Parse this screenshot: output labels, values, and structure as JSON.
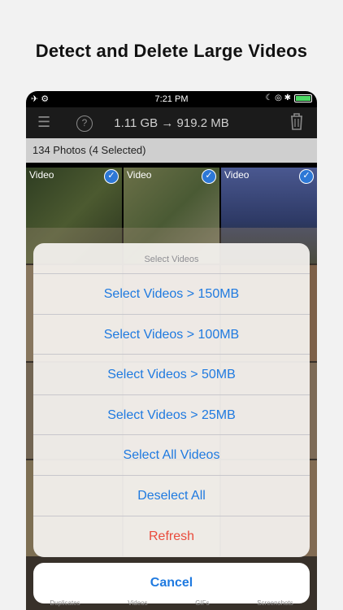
{
  "headline": "Detect and Delete Large Videos",
  "status": {
    "time": "7:21 PM",
    "left_icons": "✈ ⚙",
    "right_icons": "☾ ◎ ✱"
  },
  "toolbar": {
    "size_text": "1.11 GB → 919.2 MB",
    "help_label": "?"
  },
  "count_text": "134 Photos (4 Selected)",
  "tiles": [
    {
      "label": "Video",
      "selected": true,
      "color": "#3b4a2a"
    },
    {
      "label": "Video",
      "selected": true,
      "color": "#566040"
    },
    {
      "label": "Video",
      "selected": true,
      "color": "#3e4a78"
    }
  ],
  "sheet": {
    "title": "Select Videos",
    "options": [
      "Select Videos > 150MB",
      "Select Videos > 100MB",
      "Select Videos > 50MB",
      "Select Videos > 25MB",
      "Select All Videos",
      "Deselect All",
      "Refresh"
    ],
    "cancel": "Cancel"
  },
  "tabbar": [
    "Duplicates",
    "Videos",
    "GIFs",
    "Screenshots"
  ],
  "colors": {
    "accent": "#1f7ae0",
    "destructive": "#e94b3c",
    "check": "#2d78d6"
  }
}
